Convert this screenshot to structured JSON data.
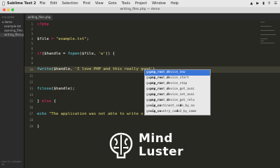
{
  "menubar": {
    "app_name": "Sublime Text 2",
    "items": [
      "File",
      "Edit",
      "Selection",
      "Find",
      "View",
      "Goto",
      "Tools",
      "Project",
      "Window",
      "Help"
    ]
  },
  "window": {
    "title": "writing_files.php — demo"
  },
  "sidebar": {
    "header": "FOLDERS",
    "rows": [
      "demo",
      "example.txt",
      "opening_files.php",
      "writing_files.php"
    ],
    "bottom": "Line 10, Column 44"
  },
  "tab": {
    "label": "writing_files.php"
  },
  "editor": {
    "line_numbers": [
      "1",
      "2",
      "3",
      "4",
      "5",
      "6",
      "7",
      "8",
      "9",
      "10",
      "11",
      "12",
      "13",
      "14",
      "15",
      "16",
      "17",
      "18",
      "19"
    ],
    "code": {
      "l1": "<?php",
      "l4_var": "$file",
      "l4_eq": " = ",
      "l4_str": "\"example.txt\"",
      "l4_end": ";",
      "l7_kw": "if",
      "l7_a": "($handle = ",
      "l7_fn": "fopen",
      "l7_b": "($file, ",
      "l7_str": "'w'",
      "l7_c": ")) {",
      "l10_fn": "fwrite",
      "l10_a": "($handle, ",
      "l10_str": "'I love PHP and this really good'",
      "l10_b": ")",
      "l13_fn": "fclose",
      "l13_a": "($handle);",
      "l15_a": "} ",
      "l15_kw": "else",
      "l15_b": " {",
      "l17_fn": "echo",
      "l17_str": " \"The application was not able to write o",
      "l19": "}"
    }
  },
  "autocomplete": {
    "items": [
      {
        "pre": "gu",
        "b1": "pnp_roo",
        "m": "t_",
        "b2": "d",
        "rest": "evice_new",
        "selected": true
      },
      {
        "pre": "gu",
        "b1": "pnp_roo",
        "m": "t_",
        "b2": "d",
        "rest": "evice_start",
        "selected": false
      },
      {
        "pre": "gu",
        "b1": "pnp_roo",
        "m": "t_",
        "b2": "d",
        "rest": "evice_stop",
        "selected": false
      },
      {
        "pre": "gu",
        "b1": "pnp_roo",
        "m": "t_",
        "b2": "d",
        "rest": "evice_get_avai",
        "selected": false
      },
      {
        "pre": "gu",
        "b1": "pnp_roo",
        "m": "t_",
        "b2": "d",
        "rest": "evice_set_avai",
        "selected": false
      },
      {
        "pre": "gu",
        "b1": "pnp_roo",
        "m": "t_",
        "b2": "d",
        "rest": "evice_get_rela",
        "selected": false
      },
      {
        "pre": "ge",
        "b1": "oip_co",
        "m": "ntinent_co",
        "b2": "d",
        "rest": "e_by_na",
        "selected": false
      },
      {
        "pre": "ge",
        "b1": "oip_co",
        "m": "untry_co",
        "b2": "d",
        "rest": "e3_by_name",
        "selected": false
      }
    ]
  },
  "watermark": {
    "line1": "Mind",
    "line2": "Luster",
    "color": "#ffffff"
  }
}
